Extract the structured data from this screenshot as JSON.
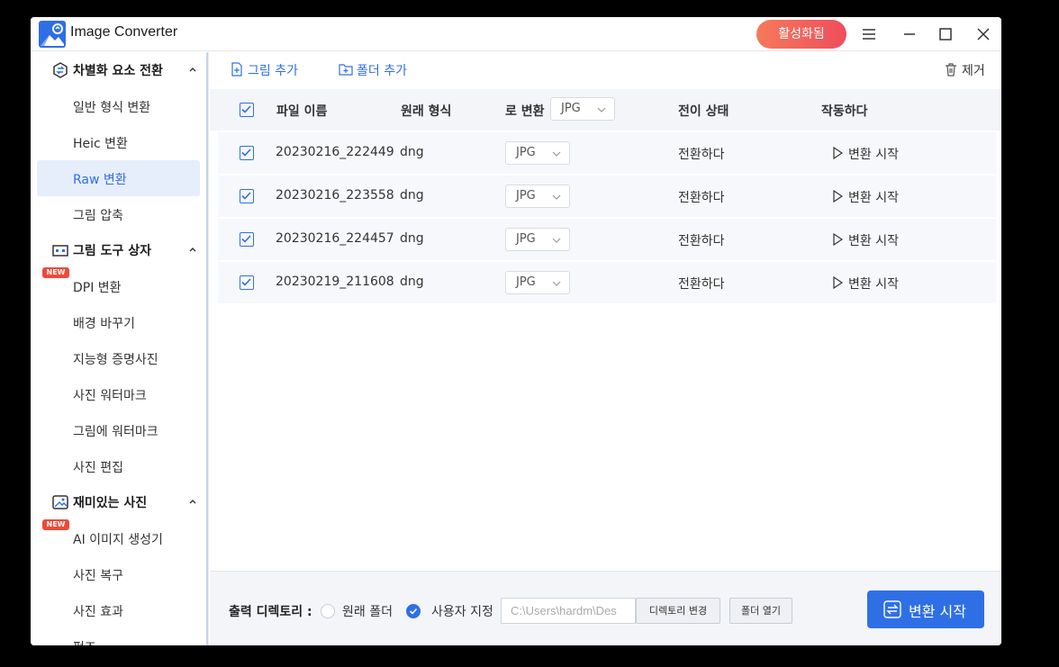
{
  "app": {
    "title": "Image Converter",
    "activate_label": "활성화됨"
  },
  "colors": {
    "accent": "#2f6fe6",
    "activate_gradient_start": "#f57a5b",
    "activate_gradient_end": "#ef4d5c",
    "new_badge": "#ee4a3a"
  },
  "sidebar": {
    "groups": [
      {
        "label": "차별화 요소 전환",
        "icon": "convert-icon",
        "items": [
          {
            "label": "일반 형식 변환"
          },
          {
            "label": "Heic 변환"
          },
          {
            "label": "Raw 변환",
            "active": true
          },
          {
            "label": "그림 압축"
          }
        ]
      },
      {
        "label": "그림 도구 상자",
        "icon": "toolbox-icon",
        "items": [
          {
            "label": "DPI 변환",
            "badge": "NEW"
          },
          {
            "label": "배경 바꾸기"
          },
          {
            "label": "지능형 증명사진"
          },
          {
            "label": "사진 워터마크"
          },
          {
            "label": "그림에 워터마크"
          },
          {
            "label": "사진 편집"
          }
        ]
      },
      {
        "label": "재미있는 사진",
        "icon": "picture-icon",
        "items": [
          {
            "label": "AI 이미지 생성기",
            "badge": "NEW"
          },
          {
            "label": "사진 복구"
          },
          {
            "label": "사진 효과"
          },
          {
            "label": "펀즈"
          }
        ]
      }
    ]
  },
  "toolbar": {
    "add_image": "그림 추가",
    "add_folder": "폴더 추가",
    "remove": "제거"
  },
  "table": {
    "headers": {
      "filename": "파일 이름",
      "original_format": "원래 형식",
      "convert_to": "로 변환",
      "status": "전이 상태",
      "action": "작동하다"
    },
    "convert_to_all": "JPG",
    "rows": [
      {
        "filename": "20230216_222449",
        "format": "dng",
        "target": "JPG",
        "status": "전환하다",
        "action": "변환 시작"
      },
      {
        "filename": "20230216_223558",
        "format": "dng",
        "target": "JPG",
        "status": "전환하다",
        "action": "변환 시작"
      },
      {
        "filename": "20230216_224457",
        "format": "dng",
        "target": "JPG",
        "status": "전환하다",
        "action": "변환 시작"
      },
      {
        "filename": "20230219_211608",
        "format": "dng",
        "target": "JPG",
        "status": "전환하다",
        "action": "변환 시작"
      }
    ]
  },
  "footer": {
    "output_label": "출력 디렉토리 :",
    "option_original": "원래 폴더",
    "option_custom": "사용자 지정",
    "path_value": "C:\\Users\\hardm\\Des",
    "change_dir": "디렉토리 변경",
    "open_folder": "폴더 열기",
    "convert_button": "변환 시작"
  }
}
